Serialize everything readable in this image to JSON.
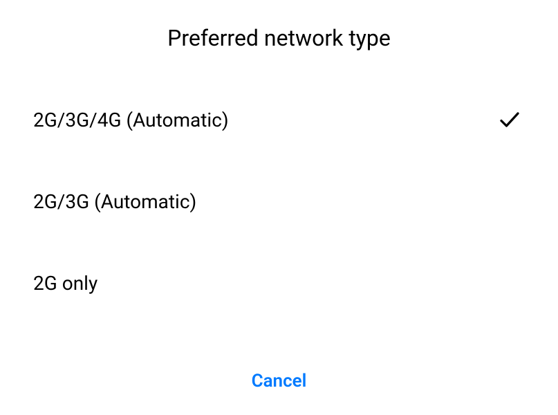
{
  "dialog": {
    "title": "Preferred network type",
    "options": [
      {
        "label": "2G/3G/4G (Automatic)",
        "selected": true
      },
      {
        "label": "2G/3G (Automatic)",
        "selected": false
      },
      {
        "label": "2G only",
        "selected": false
      }
    ],
    "cancel_label": "Cancel"
  }
}
